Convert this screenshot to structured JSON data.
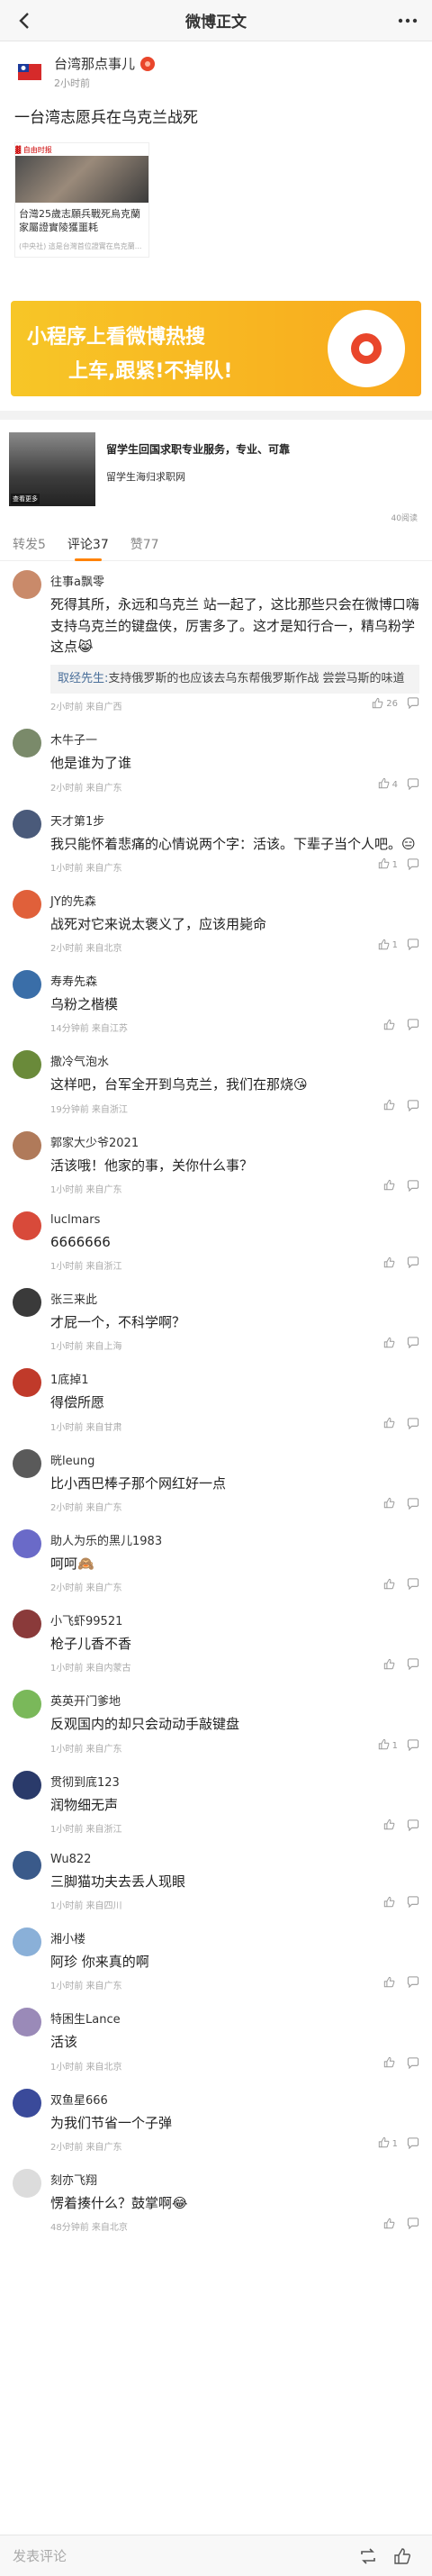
{
  "navbar": {
    "title": "微博正文"
  },
  "post": {
    "author_name": "台湾那点事儿",
    "time": "2小时前",
    "text": "一台湾志愿兵在乌克兰战死",
    "article": {
      "source": "▓ 自由时报",
      "title": "台灣25歲志願兵戰死烏克蘭 家屬證實陵獲噩耗",
      "meta": "(中央社) 這是台灣首位證實在烏克蘭..."
    }
  },
  "banner": {
    "line1": "小程序上看微博热搜",
    "line2": "上车,跟紧!不掉队!"
  },
  "ad": {
    "title": "留学生回国求职专业服务，专业、可靠",
    "subtitle": "留学生海归求职网",
    "reads": "40阅读",
    "img_tag": "查看更多"
  },
  "tabs": [
    {
      "label": "转发5",
      "active": false
    },
    {
      "label": "评论37",
      "active": true
    },
    {
      "label": "赞77",
      "active": false
    }
  ],
  "comments": [
    {
      "name": "往事a飘零",
      "text": "死得其所，永远和乌克兰 站一起了，这比那些只会在微博口嗨支持乌克兰的键盘侠，厉害多了。这才是知行合一，精乌粉学这点😹",
      "meta": "2小时前 来自广西",
      "likes": "26",
      "avatar_color": "#c98a6a",
      "reply": {
        "name": "取经先生:",
        "text": "支持俄罗斯的也应该去乌东帮俄罗斯作战 尝尝马斯的味道"
      }
    },
    {
      "name": "木牛子一",
      "text": "他是谁为了谁",
      "meta": "2小时前 来自广东",
      "likes": "4",
      "avatar_color": "#7a8a6a"
    },
    {
      "name": "天才第1步",
      "text": "我只能怀着悲痛的心情说两个字：活该。下辈子当个人吧。😑",
      "meta": "1小时前 来自广东",
      "likes": "1",
      "avatar_color": "#4a5a7a"
    },
    {
      "name": "JY的先森",
      "text": "战死对它来说太褒义了，应该用毙命",
      "meta": "2小时前 来自北京",
      "likes": "1",
      "avatar_color": "#e0603a"
    },
    {
      "name": "寿寿先森",
      "text": "乌粉之楷模",
      "meta": "14分钟前 来自江苏",
      "likes": "",
      "avatar_color": "#3a6ea8"
    },
    {
      "name": "撒冷气泡水",
      "text": "这样吧，台军全开到乌克兰，我们在那烧😘",
      "meta": "19分钟前 来自浙江",
      "likes": "",
      "avatar_color": "#6a8a3a"
    },
    {
      "name": "郭家大少爷2021",
      "text": "活该哦！他家的事，关你什么事？",
      "meta": "1小时前 来自广东",
      "likes": "",
      "avatar_color": "#b07a5a"
    },
    {
      "name": "luclmars",
      "text": "6666666",
      "meta": "1小时前 来自浙江",
      "likes": "",
      "avatar_color": "#d84a3a"
    },
    {
      "name": "张三来此",
      "text": "才屁一个，不科学啊？",
      "meta": "1小时前 来自上海",
      "likes": "",
      "avatar_color": "#3a3a3a"
    },
    {
      "name": "1底掉1",
      "text": "得偿所愿",
      "meta": "1小时前 来自甘肃",
      "likes": "",
      "avatar_color": "#c03a2a"
    },
    {
      "name": "晄leung",
      "text": "比小西巴棒子那个网红好一点",
      "meta": "2小时前 来自广东",
      "likes": "",
      "avatar_color": "#5a5a5a"
    },
    {
      "name": "助人为乐的黑儿1983",
      "text": "呵呵🙈",
      "meta": "2小时前 来自广东",
      "likes": "",
      "avatar_color": "#6a6ac8"
    },
    {
      "name": "小飞虾99521",
      "text": "枪子儿香不香",
      "meta": "1小时前 来自内蒙古",
      "likes": "",
      "avatar_color": "#8a3a3a"
    },
    {
      "name": "英英开门爹地",
      "text": "反观国内的却只会动动手敲键盘",
      "meta": "1小时前 来自广东",
      "likes": "1",
      "avatar_color": "#7ab85a"
    },
    {
      "name": "贯彻到底123",
      "text": "润物细无声",
      "meta": "1小时前 来自浙江",
      "likes": "",
      "avatar_color": "#2a3a6a"
    },
    {
      "name": "Wu822",
      "text": "三脚猫功夫去丢人现眼",
      "meta": "1小时前 来自四川",
      "likes": "",
      "avatar_color": "#3a5a8a"
    },
    {
      "name": "湘小楼",
      "text": "阿珍 你来真的啊",
      "meta": "1小时前 来自广东",
      "likes": "",
      "avatar_color": "#8ab0d8"
    },
    {
      "name": "特困生Lance",
      "text": "活该",
      "meta": "1小时前 来自北京",
      "likes": "",
      "avatar_color": "#9a8ab8"
    },
    {
      "name": "双鱼星666",
      "text": "为我们节省一个子弹",
      "meta": "2小时前 来自广东",
      "likes": "1",
      "avatar_color": "#3a4a9a"
    },
    {
      "name": "刻亦飞翔",
      "text": "愣着揍什么？鼓掌啊😂",
      "meta": "48分钟前 来自北京",
      "likes": "",
      "avatar_color": "#dcdcdc"
    }
  ],
  "bottom_bar": {
    "placeholder": "发表评论"
  }
}
